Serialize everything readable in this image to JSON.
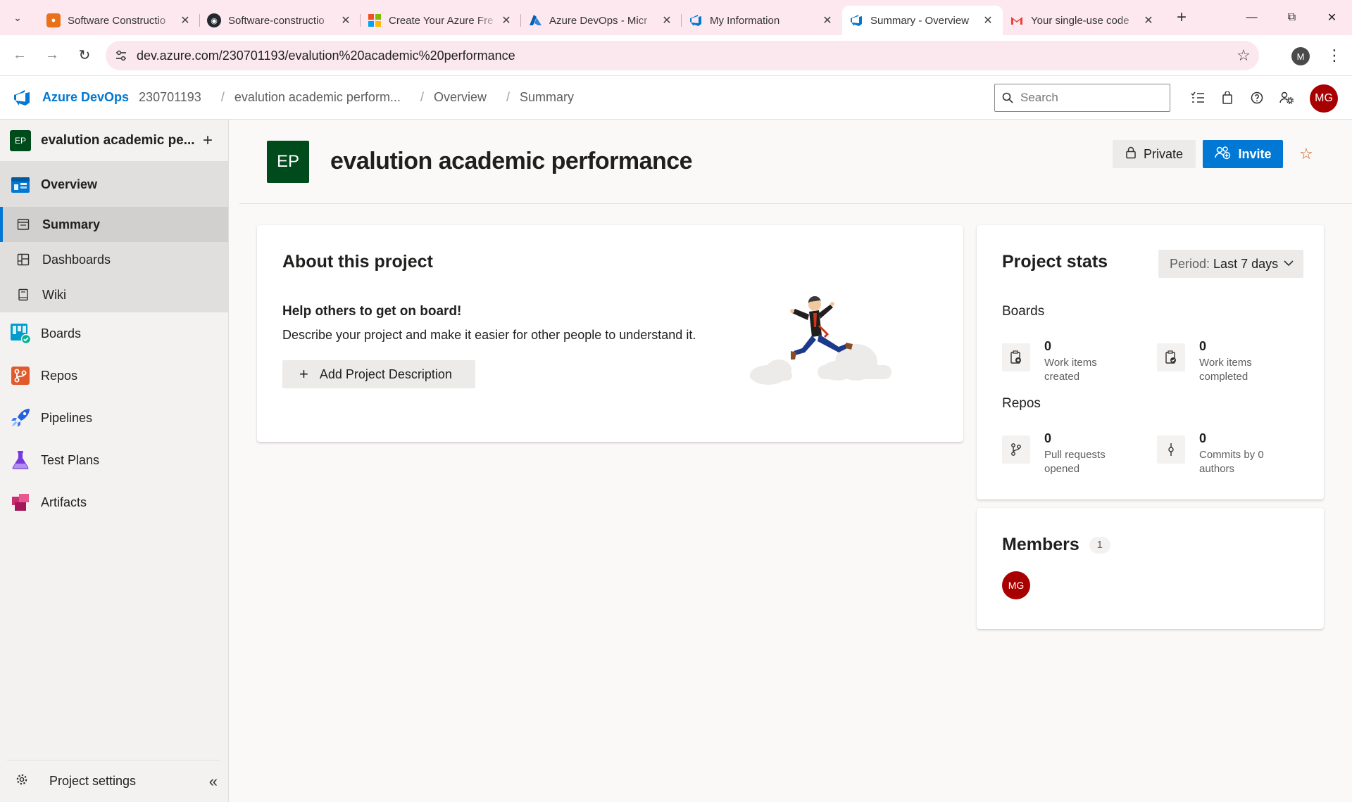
{
  "browser": {
    "tabs": [
      {
        "title": "Software Constructio",
        "favicon": "orange-square-icon",
        "color": "#e8711a",
        "active": false
      },
      {
        "title": "Software-constructio",
        "favicon": "github-icon",
        "color": "#24292f",
        "active": false
      },
      {
        "title": "Create Your Azure Fre",
        "favicon": "microsoft-icon",
        "color": "#f25022",
        "active": false
      },
      {
        "title": "Azure DevOps - Micr",
        "favicon": "azure-icon",
        "color": "#0078d4",
        "active": false
      },
      {
        "title": "My Information",
        "favicon": "devops-icon",
        "color": "#0078d4",
        "active": false
      },
      {
        "title": "Summary - Overview",
        "favicon": "devops-icon",
        "color": "#0078d4",
        "active": true
      },
      {
        "title": "Your single-use code",
        "favicon": "gmail-icon",
        "color": "#ea4335",
        "active": false
      }
    ],
    "url": "dev.azure.com/230701193/evalution%20academic%20performance",
    "profile_initial": "M"
  },
  "header": {
    "brand": "Azure DevOps",
    "org": "230701193",
    "breadcrumb": [
      "evalution academic perform...",
      "Overview",
      "Summary"
    ],
    "search_placeholder": "Search",
    "avatar": "MG"
  },
  "sidebar": {
    "project_badge": "EP",
    "project_name": "evalution academic pe...",
    "overview_label": "Overview",
    "sub_items": [
      {
        "label": "Summary",
        "active": true
      },
      {
        "label": "Dashboards",
        "active": false
      },
      {
        "label": "Wiki",
        "active": false
      }
    ],
    "items": [
      {
        "label": "Boards"
      },
      {
        "label": "Repos"
      },
      {
        "label": "Pipelines"
      },
      {
        "label": "Test Plans"
      },
      {
        "label": "Artifacts"
      }
    ],
    "footer_label": "Project settings"
  },
  "main": {
    "badge": "EP",
    "title": "evalution academic performance",
    "private_label": "Private",
    "invite_label": "Invite",
    "about": {
      "title": "About this project",
      "help_title": "Help others to get on board!",
      "help_desc": "Describe your project and make it easier for other people to understand it.",
      "add_label": "Add Project Description"
    },
    "stats": {
      "title": "Project stats",
      "period_label": "Period:",
      "period_value": "Last 7 days",
      "boards_label": "Boards",
      "repos_label": "Repos",
      "boards": [
        {
          "value": "0",
          "label": "Work items created"
        },
        {
          "value": "0",
          "label": "Work items completed"
        }
      ],
      "repos": [
        {
          "value": "0",
          "label": "Pull requests opened"
        },
        {
          "value": "0",
          "label": "Commits by 0 authors"
        }
      ]
    },
    "members": {
      "title": "Members",
      "count": "1",
      "avatar": "MG"
    }
  },
  "colors": {
    "accent": "#0078d4",
    "project_badge": "#004b1c",
    "avatar": "#a80000",
    "star": "#c75a17"
  }
}
